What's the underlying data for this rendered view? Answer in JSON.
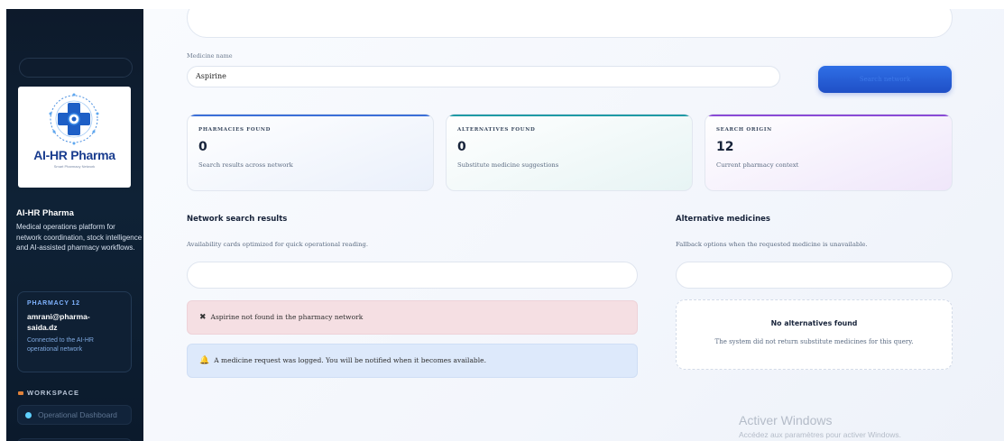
{
  "brand": {
    "logo_text": "AI-HR Pharma",
    "logo_tagline": "Smart Pharmacy Network",
    "name": "AI-HR Pharma",
    "description": "Medical operations platform for network coordination, stock intelligence and AI-assisted pharmacy workflows."
  },
  "pharmacy": {
    "label": "PHARMACY 12",
    "email": "amrani@pharma-saida.dz",
    "status": "Connected to the AI-HR operational network"
  },
  "sidebar": {
    "section_label": "WORKSPACE",
    "items": [
      {
        "label": "Operational Dashboard",
        "icon": "dot-icon"
      }
    ]
  },
  "search": {
    "medicine_label": "Medicine name",
    "medicine_value": "Aspirine",
    "button_label": "Search network"
  },
  "stats": [
    {
      "label": "PHARMACIES FOUND",
      "value": "0",
      "desc": "Search results across network",
      "accent": "#3b6fd8"
    },
    {
      "label": "ALTERNATIVES FOUND",
      "value": "0",
      "desc": "Substitute medicine suggestions",
      "accent": "#1f9aa5"
    },
    {
      "label": "SEARCH ORIGIN",
      "value": "12",
      "desc": "Current pharmacy context",
      "accent": "#8a4ad6"
    }
  ],
  "results": {
    "title": "Network search results",
    "subtitle": "Availability cards optimized for quick operational reading.",
    "error": "Aspirine not found in the pharmacy network",
    "info": "A medicine request was logged. You will be notified when it becomes available."
  },
  "alternatives": {
    "title": "Alternative medicines",
    "subtitle": "Fallback options when the requested medicine is unavailable.",
    "empty_title": "No alternatives found",
    "empty_desc": "The system did not return substitute medicines for this query."
  },
  "watermark": {
    "title": "Activer Windows",
    "subtitle": "Accédez aux paramètres pour activer Windows."
  }
}
